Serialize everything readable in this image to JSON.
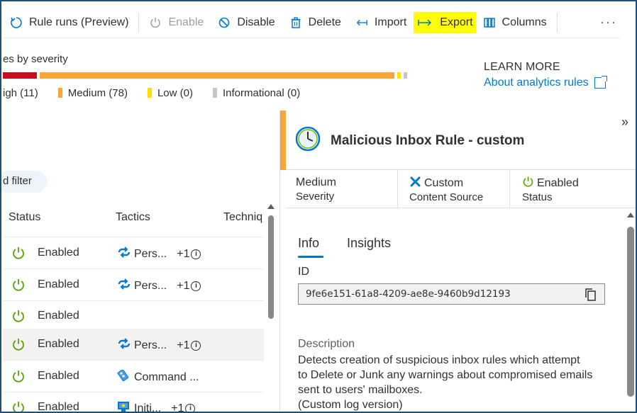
{
  "toolbar": {
    "rule_runs": "Rule runs (Preview)",
    "enable": "Enable",
    "disable": "Disable",
    "delete": "Delete",
    "import": "Import",
    "export": "Export",
    "columns": "Columns",
    "more": "···"
  },
  "severity": {
    "title": "es by severity",
    "levels": [
      {
        "label": "igh (11)",
        "count": 11,
        "color": "#c50f1f"
      },
      {
        "label": "Medium  (78)",
        "count": 78,
        "color": "#f7a63a"
      },
      {
        "label": "Low (0)",
        "count": 0,
        "color": "#ffe000"
      },
      {
        "label": "Informational (0)",
        "count": 0,
        "color": "#c8c6c4"
      }
    ]
  },
  "learn_more": {
    "header": "LEARN MORE",
    "link": "About analytics rules"
  },
  "list": {
    "filter_pill": "d filter",
    "columns": [
      "Status",
      "Tactics",
      "Techniq"
    ],
    "rows": [
      {
        "status": "Enabled",
        "tactic": "Pers...",
        "extra": "+1",
        "tactic_icon": "persistence-icon"
      },
      {
        "status": "Enabled",
        "tactic": "Pers...",
        "extra": "+1",
        "tactic_icon": "persistence-icon"
      },
      {
        "status": "Enabled",
        "tactic": "",
        "extra": "",
        "tactic_icon": ""
      },
      {
        "status": "Enabled",
        "tactic": "Pers...",
        "extra": "+1",
        "tactic_icon": "persistence-icon"
      },
      {
        "status": "Enabled",
        "tactic": "Command ...",
        "extra": "",
        "tactic_icon": "command-control-icon"
      },
      {
        "status": "Enabled",
        "tactic": "Initi...",
        "extra": "+1",
        "tactic_icon": "initial-access-icon"
      }
    ]
  },
  "panel": {
    "title": "Malicious Inbox Rule - custom",
    "severity_value": "Medium",
    "severity_label": "Severity",
    "source_value": "Custom",
    "source_label": "Content Source",
    "status_value": "Enabled",
    "status_label": "Status",
    "tabs": [
      "Info",
      "Insights"
    ],
    "id_label": "ID",
    "id_value": "9fe6e151-61a8-4209-ae8e-9460b9d12193",
    "desc_label": "Description",
    "desc_text": "Detects creation of suspicious inbox rules which attempt\nto Delete or Junk any warnings about compromised emails\nsent to users' mailboxes.\n(Custom log version)",
    "collapse": "»"
  },
  "colors": {
    "accent": "#0078d4",
    "medium": "#f7a63a",
    "enabled_green": "#57a300",
    "highlight": "#ffff00"
  }
}
